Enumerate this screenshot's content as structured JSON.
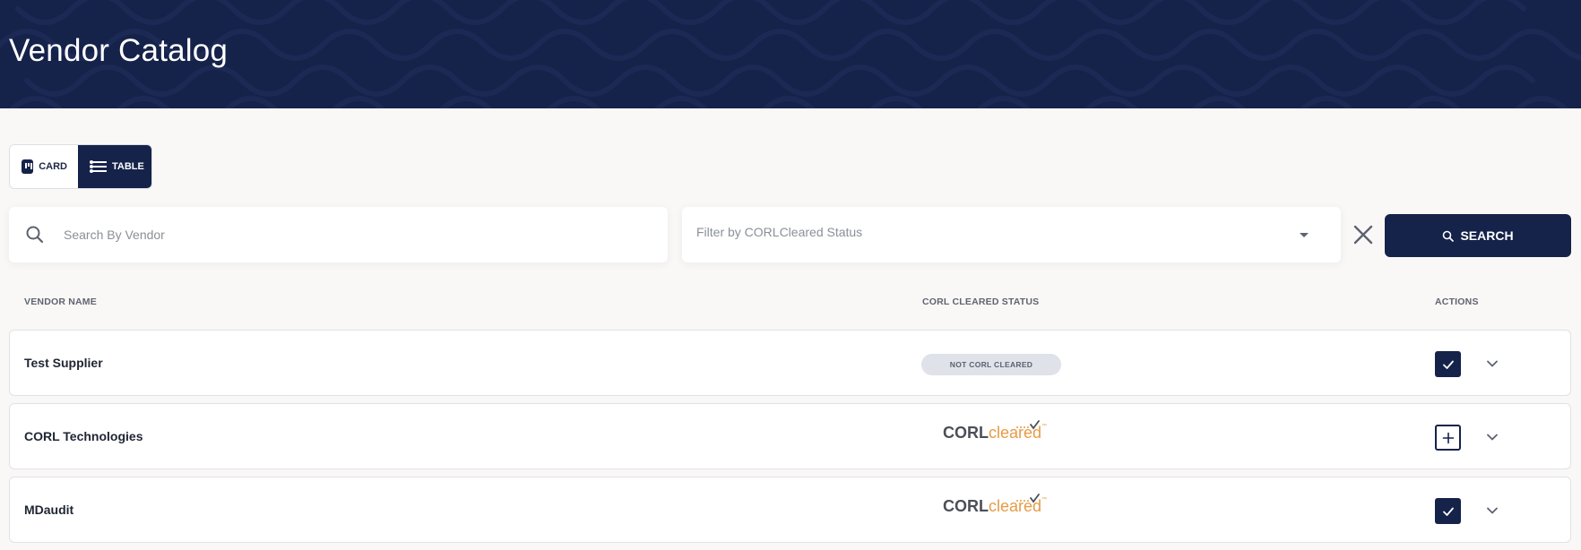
{
  "header": {
    "title": "Vendor Catalog"
  },
  "view_toggle": {
    "card_label": "CARD",
    "table_label": "TABLE",
    "active": "table"
  },
  "search": {
    "placeholder": "Search By Vendor",
    "value": ""
  },
  "filter": {
    "placeholder": "Filter by CORLCleared Status"
  },
  "search_button": {
    "label": "SEARCH"
  },
  "table": {
    "columns": {
      "vendor": "VENDOR NAME",
      "status": "CORL CLEARED STATUS",
      "actions": "ACTIONS"
    },
    "rows": [
      {
        "vendor": "Test Supplier",
        "status": "NOT CORL CLEARED",
        "cleared": false,
        "action": "selected"
      },
      {
        "vendor": "CORL Technologies",
        "status": "CORLcleared",
        "cleared": true,
        "action": "add"
      },
      {
        "vendor": "MDaudit",
        "status": "CORLcleared",
        "cleared": true,
        "action": "selected"
      }
    ]
  },
  "logo_text": {
    "corl": "CORL",
    "cleared": "cleared",
    "tm": "™"
  },
  "colors": {
    "navy": "#15224a",
    "orange": "#e69b45",
    "background": "#faf8f6"
  }
}
